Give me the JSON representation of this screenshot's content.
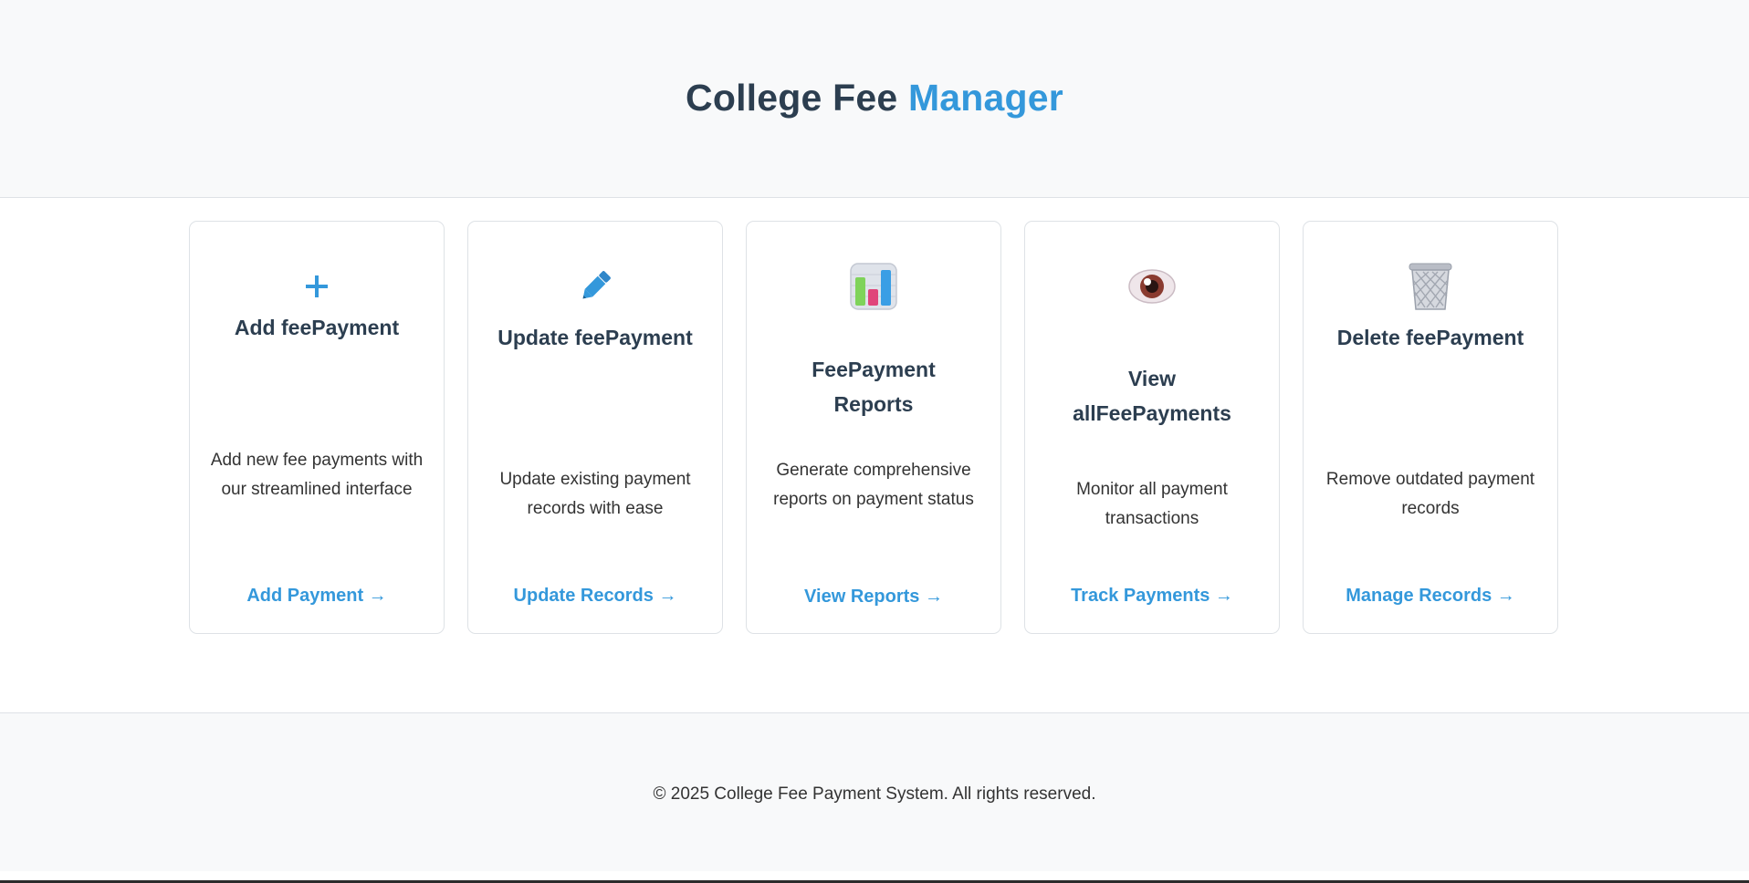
{
  "header": {
    "title_main": "College Fee ",
    "title_accent": "Manager"
  },
  "cards": [
    {
      "icon": "plus-icon",
      "title": "Add feePayment",
      "description": "Add new fee payments with our streamlined interface",
      "link": "Add Payment →"
    },
    {
      "icon": "pencil-icon",
      "title": "Update feePayment",
      "description": "Update existing payment records with ease",
      "link": "Update Records →"
    },
    {
      "icon": "bar-chart-icon",
      "title": "FeePayment Reports",
      "description": "Generate comprehensive reports on payment status",
      "link": "View Reports →"
    },
    {
      "icon": "eye-icon",
      "title": "View allFeePayments",
      "description": "Monitor all payment transactions",
      "link": "Track Payments →"
    },
    {
      "icon": "wastebasket-icon",
      "title": "Delete feePayment",
      "description": "Remove outdated payment records",
      "link": "Manage Records →"
    }
  ],
  "footer": {
    "text": "© 2025 College Fee Payment System. All rights reserved."
  },
  "colors": {
    "accent": "#3498db",
    "heading": "#2c3e50",
    "background_light": "#f8f9fa",
    "border": "#dee2e6"
  }
}
